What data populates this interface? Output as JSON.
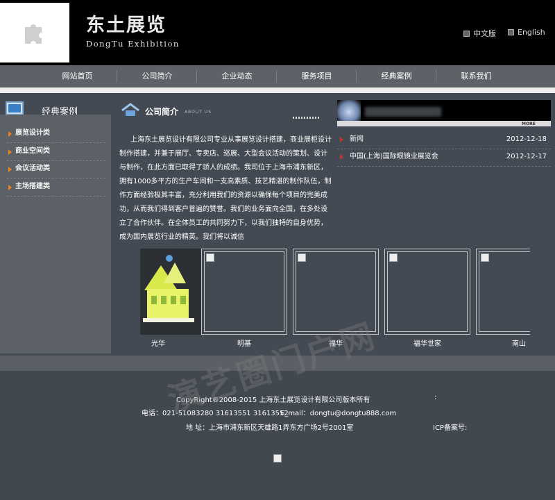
{
  "header": {
    "brand_cn": "东土展览",
    "brand_en": "DongTu Exhibition",
    "lang_cn": "中文版",
    "lang_en": "English"
  },
  "nav": {
    "items": [
      "网站首页",
      "公司简介",
      "企业动态",
      "服务项目",
      "经典案例",
      "联系我们"
    ]
  },
  "sidebar": {
    "title": "经典案例",
    "categories": [
      "展览设计类",
      "商业空间类",
      "会议活动类",
      "主场搭建类"
    ]
  },
  "about": {
    "title": "公司简介",
    "subtitle": "ABOUT US",
    "text": "上海东土展览设计有限公司专业从事展览设计搭建，商业展柜设计制作搭建，并兼于展厅、专卖店、巡展、大型会议活动的策划、设计与制作，在此方面已取得了骄人的成绩。我司位于上海市浦东新区，拥有1000多平方的生产车间和一支高素质、技艺精湛的制作队伍，制作方面经验极其丰富，充分利用我们的资源以确保每个项目的完美成功，从而我们得到客户普遍的赞誉。我们的业务面向全国，在多处设立了合作伙伴。在全体员工的共同努力下，以我们独特的自身优势，成为国内展览行业的精英。我们将以诚信"
  },
  "news": {
    "more": "MORE",
    "items": [
      {
        "title": "新闻",
        "date": "2012-12-18"
      },
      {
        "title": "中国(上海)国际眼镜业展览会",
        "date": "2012-12-17"
      }
    ]
  },
  "gallery": {
    "items": [
      {
        "label": "光华"
      },
      {
        "label": "明基"
      },
      {
        "label": "福华"
      },
      {
        "label": "福华世家"
      },
      {
        "label": "南山"
      }
    ]
  },
  "footer": {
    "copyright": "CopyRight®2008-2015 上海东土展览设计有限公司版本所有",
    "colon": ":",
    "phone": "电话：021-51083280 31613551 31613552",
    "email": "E_mail：dongtu@dongtu888.com",
    "address": "地 址：上海市浦东新区天雄路1弄东方广场2号2001室",
    "icp": "ICP备案号:"
  },
  "watermark": "演艺圈门户网"
}
